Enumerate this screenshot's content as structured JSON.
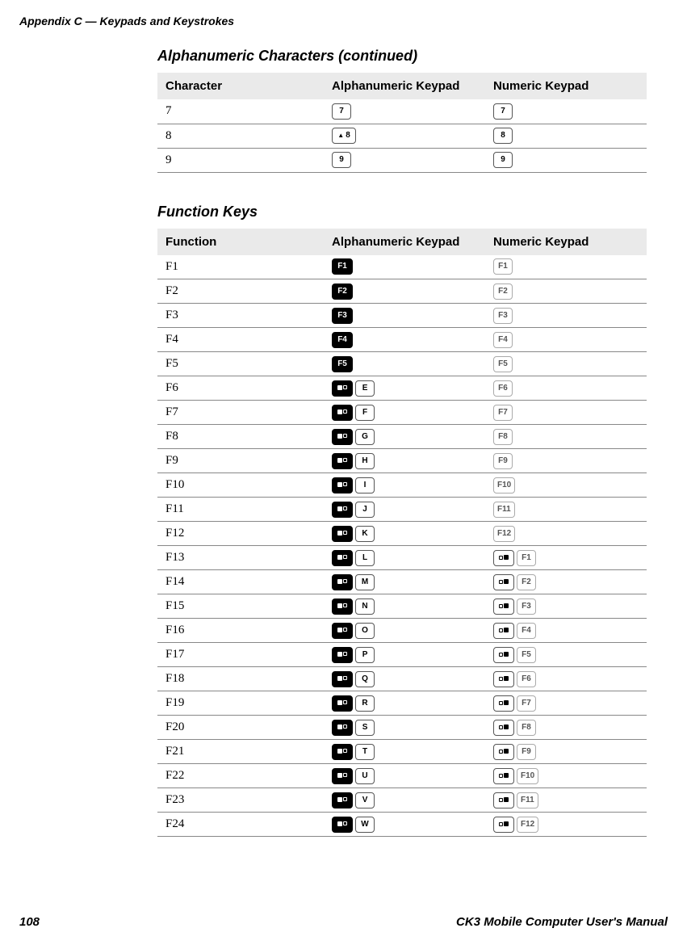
{
  "header": {
    "appendix": "Appendix C — Keypads and Keystrokes"
  },
  "section1": {
    "title": "Alphanumeric Characters (continued)",
    "columns": [
      "Character",
      "Alphanumeric Keypad",
      "Numeric Keypad"
    ],
    "rows": [
      {
        "char": "7",
        "alphaKeys": [
          {
            "label": "7",
            "style": "plain"
          }
        ],
        "numKeys": [
          {
            "label": "7",
            "style": "plain"
          }
        ]
      },
      {
        "char": "8",
        "alphaKeys": [
          {
            "label": "8",
            "style": "shift"
          }
        ],
        "numKeys": [
          {
            "label": "8",
            "style": "plain"
          }
        ]
      },
      {
        "char": "9",
        "alphaKeys": [
          {
            "label": "9",
            "style": "plain"
          }
        ],
        "numKeys": [
          {
            "label": "9",
            "style": "plain"
          }
        ]
      }
    ]
  },
  "section2": {
    "title": "Function Keys",
    "columns": [
      "Function",
      "Alphanumeric Keypad",
      "Numeric Keypad"
    ],
    "rows": [
      {
        "fn": "F1",
        "alphaKeys": [
          {
            "label": "F1",
            "style": "black"
          }
        ],
        "numKeys": [
          {
            "label": "F1",
            "style": "dull"
          }
        ]
      },
      {
        "fn": "F2",
        "alphaKeys": [
          {
            "label": "F2",
            "style": "black"
          }
        ],
        "numKeys": [
          {
            "label": "F2",
            "style": "dull"
          }
        ]
      },
      {
        "fn": "F3",
        "alphaKeys": [
          {
            "label": "F3",
            "style": "black"
          }
        ],
        "numKeys": [
          {
            "label": "F3",
            "style": "dull"
          }
        ]
      },
      {
        "fn": "F4",
        "alphaKeys": [
          {
            "label": "F4",
            "style": "black"
          }
        ],
        "numKeys": [
          {
            "label": "F4",
            "style": "dull"
          }
        ]
      },
      {
        "fn": "F5",
        "alphaKeys": [
          {
            "label": "F5",
            "style": "black"
          }
        ],
        "numKeys": [
          {
            "label": "F5",
            "style": "dull"
          }
        ]
      },
      {
        "fn": "F6",
        "alphaKeys": [
          {
            "label": "",
            "style": "mod"
          },
          {
            "label": "E",
            "style": "plain"
          }
        ],
        "numKeys": [
          {
            "label": "F6",
            "style": "dull"
          }
        ]
      },
      {
        "fn": "F7",
        "alphaKeys": [
          {
            "label": "",
            "style": "mod"
          },
          {
            "label": "F",
            "style": "plain"
          }
        ],
        "numKeys": [
          {
            "label": "F7",
            "style": "dull"
          }
        ]
      },
      {
        "fn": "F8",
        "alphaKeys": [
          {
            "label": "",
            "style": "mod"
          },
          {
            "label": "G",
            "style": "plain"
          }
        ],
        "numKeys": [
          {
            "label": "F8",
            "style": "dull"
          }
        ]
      },
      {
        "fn": "F9",
        "alphaKeys": [
          {
            "label": "",
            "style": "mod"
          },
          {
            "label": "H",
            "style": "plain"
          }
        ],
        "numKeys": [
          {
            "label": "F9",
            "style": "dull"
          }
        ]
      },
      {
        "fn": "F10",
        "alphaKeys": [
          {
            "label": "",
            "style": "mod"
          },
          {
            "label": "I",
            "style": "plain"
          }
        ],
        "numKeys": [
          {
            "label": "F10",
            "style": "dull"
          }
        ]
      },
      {
        "fn": "F11",
        "alphaKeys": [
          {
            "label": "",
            "style": "mod"
          },
          {
            "label": "J",
            "style": "plain"
          }
        ],
        "numKeys": [
          {
            "label": "F11",
            "style": "dull"
          }
        ]
      },
      {
        "fn": "F12",
        "alphaKeys": [
          {
            "label": "",
            "style": "mod"
          },
          {
            "label": "K",
            "style": "plain"
          }
        ],
        "numKeys": [
          {
            "label": "F12",
            "style": "dull"
          }
        ]
      },
      {
        "fn": "F13",
        "alphaKeys": [
          {
            "label": "",
            "style": "mod"
          },
          {
            "label": "L",
            "style": "plain"
          }
        ],
        "numKeys": [
          {
            "label": "",
            "style": "nummod"
          },
          {
            "label": "F1",
            "style": "dull"
          }
        ]
      },
      {
        "fn": "F14",
        "alphaKeys": [
          {
            "label": "",
            "style": "mod"
          },
          {
            "label": "M",
            "style": "plain"
          }
        ],
        "numKeys": [
          {
            "label": "",
            "style": "nummod"
          },
          {
            "label": "F2",
            "style": "dull"
          }
        ]
      },
      {
        "fn": "F15",
        "alphaKeys": [
          {
            "label": "",
            "style": "mod"
          },
          {
            "label": "N",
            "style": "plain"
          }
        ],
        "numKeys": [
          {
            "label": "",
            "style": "nummod"
          },
          {
            "label": "F3",
            "style": "dull"
          }
        ]
      },
      {
        "fn": "F16",
        "alphaKeys": [
          {
            "label": "",
            "style": "mod"
          },
          {
            "label": "O",
            "style": "plain"
          }
        ],
        "numKeys": [
          {
            "label": "",
            "style": "nummod"
          },
          {
            "label": "F4",
            "style": "dull"
          }
        ]
      },
      {
        "fn": "F17",
        "alphaKeys": [
          {
            "label": "",
            "style": "mod"
          },
          {
            "label": "P",
            "style": "plain"
          }
        ],
        "numKeys": [
          {
            "label": "",
            "style": "nummod"
          },
          {
            "label": "F5",
            "style": "dull"
          }
        ]
      },
      {
        "fn": "F18",
        "alphaKeys": [
          {
            "label": "",
            "style": "mod"
          },
          {
            "label": "Q",
            "style": "plain"
          }
        ],
        "numKeys": [
          {
            "label": "",
            "style": "nummod"
          },
          {
            "label": "F6",
            "style": "dull"
          }
        ]
      },
      {
        "fn": "F19",
        "alphaKeys": [
          {
            "label": "",
            "style": "mod"
          },
          {
            "label": "R",
            "style": "plain"
          }
        ],
        "numKeys": [
          {
            "label": "",
            "style": "nummod"
          },
          {
            "label": "F7",
            "style": "dull"
          }
        ]
      },
      {
        "fn": "F20",
        "alphaKeys": [
          {
            "label": "",
            "style": "mod"
          },
          {
            "label": "S",
            "style": "plain"
          }
        ],
        "numKeys": [
          {
            "label": "",
            "style": "nummod"
          },
          {
            "label": "F8",
            "style": "dull"
          }
        ]
      },
      {
        "fn": "F21",
        "alphaKeys": [
          {
            "label": "",
            "style": "mod"
          },
          {
            "label": "T",
            "style": "plain"
          }
        ],
        "numKeys": [
          {
            "label": "",
            "style": "nummod"
          },
          {
            "label": "F9",
            "style": "dull"
          }
        ]
      },
      {
        "fn": "F22",
        "alphaKeys": [
          {
            "label": "",
            "style": "mod"
          },
          {
            "label": "U",
            "style": "plain"
          }
        ],
        "numKeys": [
          {
            "label": "",
            "style": "nummod"
          },
          {
            "label": "F10",
            "style": "dull"
          }
        ]
      },
      {
        "fn": "F23",
        "alphaKeys": [
          {
            "label": "",
            "style": "mod"
          },
          {
            "label": "V",
            "style": "plain"
          }
        ],
        "numKeys": [
          {
            "label": "",
            "style": "nummod"
          },
          {
            "label": "F11",
            "style": "dull"
          }
        ]
      },
      {
        "fn": "F24",
        "alphaKeys": [
          {
            "label": "",
            "style": "mod"
          },
          {
            "label": "W",
            "style": "plain"
          }
        ],
        "numKeys": [
          {
            "label": "",
            "style": "nummod"
          },
          {
            "label": "F12",
            "style": "dull"
          }
        ]
      }
    ]
  },
  "footer": {
    "pageNumber": "108",
    "manualTitle": "CK3 Mobile Computer User's Manual"
  }
}
